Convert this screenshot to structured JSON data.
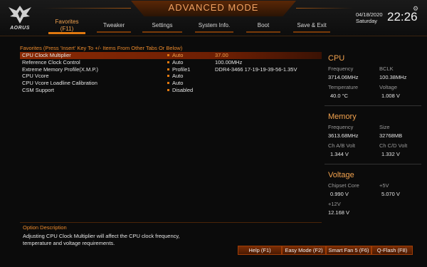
{
  "brand": "AORUS",
  "mode_title": "ADVANCED MODE",
  "tabs": [
    {
      "label": "Favorites\n(F11)",
      "active": true
    },
    {
      "label": "Tweaker"
    },
    {
      "label": "Settings"
    },
    {
      "label": "System Info."
    },
    {
      "label": "Boot"
    },
    {
      "label": "Save & Exit"
    }
  ],
  "datetime": {
    "date": "04/18/2020",
    "day": "Saturday",
    "time": "22:26"
  },
  "favorites": {
    "title": "Favorites (Press 'Insert' Key To +/- Items From Other Tabs Or Below)",
    "items": [
      {
        "label": "CPU Clock Multiplier",
        "value": "Auto",
        "extra": "37.00",
        "selected": true
      },
      {
        "label": "Reference Clock Control",
        "value": "Auto",
        "extra": "100.00MHz"
      },
      {
        "label": "Extreme Memory Profile(X.M.P.)",
        "value": "Profile1",
        "extra": "DDR4-3466 17-19-19-39-56-1.35V"
      },
      {
        "label": "CPU Vcore",
        "value": "Auto",
        "extra": ""
      },
      {
        "label": "CPU Vcore Loadline Calibration",
        "value": "Auto",
        "extra": ""
      },
      {
        "label": "CSM Support",
        "value": "Disabled",
        "extra": ""
      }
    ]
  },
  "cpu": {
    "title": "CPU",
    "frequency_label": "Frequency",
    "frequency": "3714.06MHz",
    "bclk_label": "BCLK",
    "bclk": "100.38MHz",
    "temperature_label": "Temperature",
    "temperature": "40.0 °C",
    "voltage_label": "Voltage",
    "voltage": "1.008 V"
  },
  "memory": {
    "title": "Memory",
    "frequency_label": "Frequency",
    "frequency": "3613.68MHz",
    "size_label": "Size",
    "size": "32768MB",
    "chab_label": "Ch A/B Volt",
    "chab": "1.344 V",
    "chcd_label": "Ch C/D Volt",
    "chcd": "1.332 V"
  },
  "voltage": {
    "title": "Voltage",
    "chipset_label": "Chipset Core",
    "chipset": "0.990 V",
    "plus5_label": "+5V",
    "plus5": "5.070 V",
    "plus12_label": "+12V",
    "plus12": "12.168 V"
  },
  "option": {
    "title": "Option Description",
    "line1": "Adjusting CPU Clock Multiplier will affect the CPU clock frequency,",
    "line2": "temperature and voltage requirements."
  },
  "footer": {
    "help": "Help (F1)",
    "easy_mode": "Easy Mode (F2)",
    "smart_fan": "Smart Fan 5 (F6)",
    "qflash": "Q-Flash (F8)"
  },
  "colors": {
    "accent": "#e0780f",
    "highlight": "#8a2a05"
  }
}
